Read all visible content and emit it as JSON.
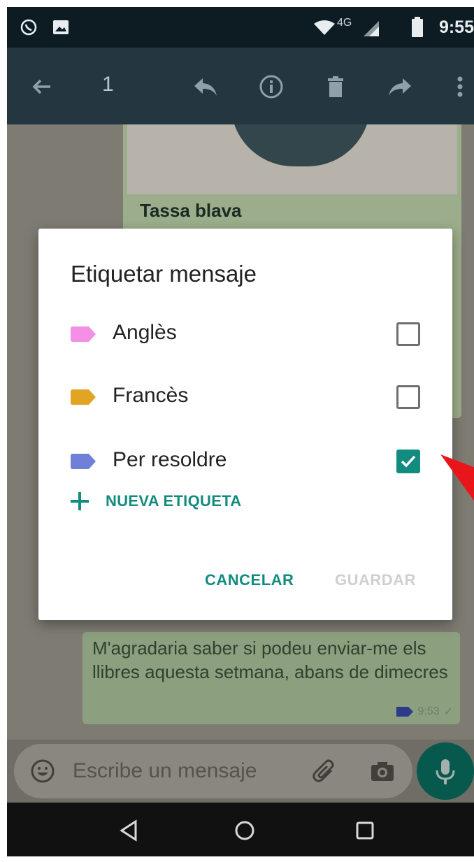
{
  "status_bar": {
    "time": "9:55",
    "network": "4G"
  },
  "action_bar": {
    "selected_count": "1"
  },
  "chat": {
    "image_caption": "Tassa blava",
    "message": {
      "text": "M'agradaria saber si podeu enviar-me els llibres aquesta setmana, abans de dimecres",
      "time": "9:53"
    }
  },
  "compose": {
    "placeholder": "Escribe un mensaje"
  },
  "dialog": {
    "title": "Etiquetar mensaje",
    "labels": [
      {
        "name": "Anglès",
        "color": "#F48FE6",
        "checked": false
      },
      {
        "name": "Francès",
        "color": "#E2A424",
        "checked": false
      },
      {
        "name": "Per resoldre",
        "color": "#7080D8",
        "checked": true
      }
    ],
    "new_label": "NUEVA ETIQUETA",
    "cancel": "CANCELAR",
    "save": "GUARDAR"
  },
  "colors": {
    "accent": "#128C7E",
    "action_bar": "#243740",
    "annotation_arrow": "#E8161B"
  },
  "icons": {
    "status_left": [
      "whatsapp-notification-icon",
      "image-notification-icon"
    ],
    "status_right": [
      "wifi-icon",
      "signal-icon",
      "battery-icon"
    ],
    "action_bar": [
      "back-arrow-icon",
      "reply-icon",
      "info-icon",
      "delete-icon",
      "forward-icon",
      "more-vert-icon"
    ],
    "compose": [
      "emoji-icon",
      "attach-icon",
      "camera-icon",
      "mic-icon"
    ],
    "nav": [
      "nav-back-icon",
      "nav-home-icon",
      "nav-recents-icon"
    ]
  }
}
